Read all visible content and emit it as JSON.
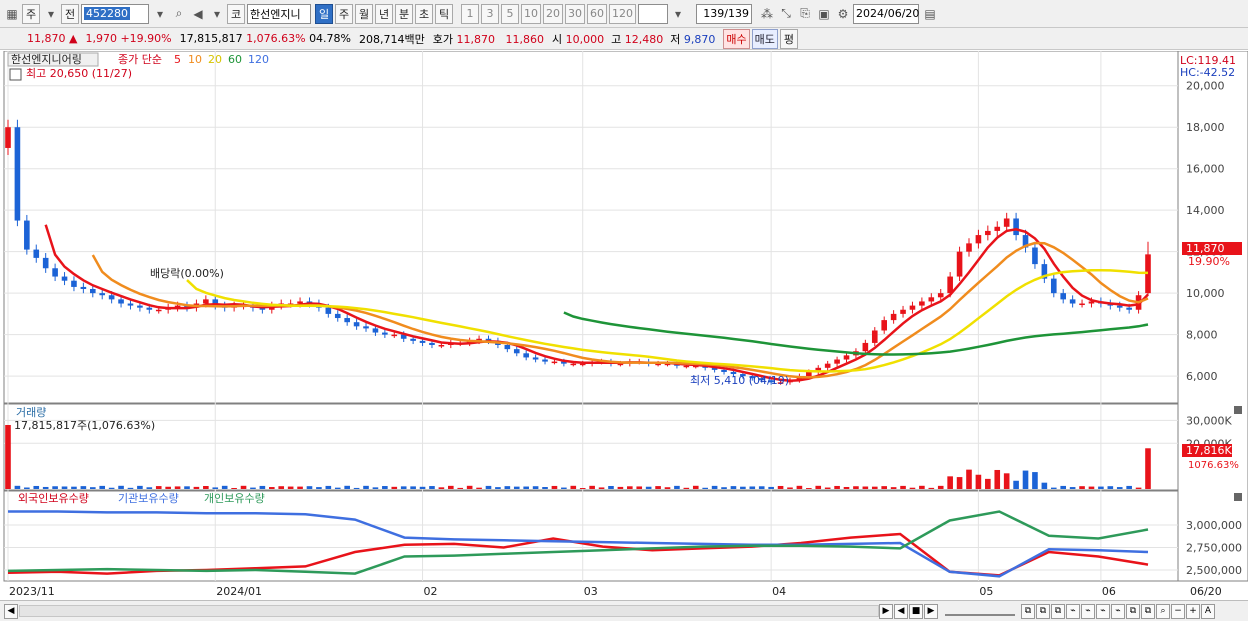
{
  "toolbar": {
    "type_label": "주",
    "prev_label": "전",
    "code": "452280",
    "stock_prefix": "코",
    "stock_name": "한선엔지니",
    "periods": [
      "일",
      "주",
      "월",
      "년",
      "분",
      "초",
      "틱"
    ],
    "active_period": "일",
    "numbers": [
      "1",
      "3",
      "5",
      "10",
      "20",
      "30",
      "60",
      "120"
    ],
    "count": "139",
    "total": "/139",
    "date": "2024/06/20"
  },
  "quote": {
    "price": "11,870",
    "arrow": "▲",
    "change": "1,970",
    "change_pct": "+19.90%",
    "volume": "17,815,817",
    "volume_pct": "1,076.63%",
    "turnover": "04.78%",
    "amount": "208,714백만",
    "bid_label": "호가",
    "ask": "11,870",
    "bid": "11,860",
    "open_label": "시",
    "open": "10,000",
    "high_label": "고",
    "high": "12,480",
    "low_label": "저",
    "low": "9,870",
    "buy_label": "매수",
    "sell_label": "매도",
    "flat_label": "평"
  },
  "price_panel": {
    "title": "한선엔지니어링",
    "ma_label": "종가 단순",
    "ma_periods": [
      "5",
      "10",
      "20",
      "60",
      "120"
    ],
    "high_note": "최고 20,650 (11/27)",
    "low_note": "최저 5,410 (04/19)",
    "dividend_note": "배당락(0.00%)",
    "lc": "LC:119.41",
    "hc": "HC:-42.52",
    "y_ticks": [
      "20,000",
      "18,000",
      "16,000",
      "14,000",
      "12,000",
      "10,000",
      "8,000",
      "6,000"
    ],
    "last_price": "11,870",
    "last_pct": "19.90%"
  },
  "volume_panel": {
    "title": "거래량",
    "note": "17,815,817주(1,076.63%)",
    "y_ticks": [
      "30,000K",
      "20,000K"
    ],
    "last_vol": "17,816K",
    "last_pct": "1076.63%"
  },
  "holding_panel": {
    "series_labels": [
      "외국인보유수량",
      "기관보유수량",
      "개인보유수량"
    ],
    "y_ticks": [
      "3,000,000",
      "2,750,000",
      "2,500,000"
    ]
  },
  "x_axis": {
    "labels": [
      "2023/11",
      "2024/01",
      "02",
      "03",
      "04",
      "05",
      "06"
    ],
    "end_label": "06/20"
  },
  "colors": {
    "up": "#e8131a",
    "down": "#1c63d6",
    "ma5": "#e8131a",
    "ma10": "#f08c1e",
    "ma20": "#f0e000",
    "ma60": "#1e9438",
    "ma120": "#3f6fe0",
    "foreign": "#e8131a",
    "institution": "#3f6fe0",
    "individual": "#2e9a5a"
  },
  "chart_data": {
    "type": "candlestick",
    "x": [
      "2023/11",
      "2024/01",
      "02",
      "03",
      "04",
      "05",
      "06",
      "06/20"
    ],
    "price_range": [
      4800,
      21000
    ],
    "price_ticks": [
      6000,
      8000,
      10000,
      12000,
      14000,
      16000,
      18000,
      20000
    ],
    "highest": {
      "value": 20650,
      "date": "11/27"
    },
    "lowest": {
      "value": 5410,
      "date": "04/19"
    },
    "last": {
      "open": 10000,
      "high": 12480,
      "low": 9870,
      "close": 11870,
      "change_pct": 19.9
    },
    "close_series": [
      18000,
      13500,
      12100,
      11700,
      11200,
      10800,
      10600,
      10300,
      10200,
      10000,
      9900,
      9700,
      9500,
      9400,
      9300,
      9200,
      9200,
      9300,
      9400,
      9300,
      9500,
      9700,
      9400,
      9300,
      9400,
      9400,
      9300,
      9200,
      9400,
      9500,
      9500,
      9600,
      9500,
      9300,
      9000,
      8800,
      8600,
      8400,
      8300,
      8100,
      8000,
      8000,
      7800,
      7700,
      7600,
      7500,
      7500,
      7600,
      7600,
      7700,
      7800,
      7700,
      7500,
      7300,
      7100,
      6900,
      6800,
      6700,
      6700,
      6600,
      6600,
      6600,
      6700,
      6700,
      6600,
      6600,
      6700,
      6700,
      6600,
      6600,
      6600,
      6500,
      6500,
      6500,
      6400,
      6300,
      6200,
      6100,
      6000,
      5900,
      5800,
      5700,
      5700,
      5800,
      6000,
      6200,
      6400,
      6600,
      6800,
      7000,
      7200,
      7600,
      8200,
      8700,
      9000,
      9200,
      9400,
      9600,
      9800,
      10000,
      10800,
      12000,
      12400,
      12800,
      13000,
      13200,
      13600,
      12800,
      12200,
      11400,
      10700,
      10000,
      9700,
      9500,
      9500,
      9600,
      9500,
      9400,
      9300,
      9200,
      9900,
      11870
    ],
    "volume_range": [
      0,
      35000
    ],
    "volume_unit": "K",
    "volume_ticks": [
      20000,
      30000
    ],
    "last_volume": 17816,
    "holding_range": [
      2400000,
      3200000
    ],
    "holding_ticks": [
      2500000,
      2750000,
      3000000
    ],
    "series": [
      {
        "name": "외국인보유수량",
        "values": [
          2470000,
          2480000,
          2460000,
          2490000,
          2500000,
          2520000,
          2540000,
          2700000,
          2780000,
          2790000,
          2750000,
          2850000,
          2760000,
          2720000,
          2740000,
          2760000,
          2800000,
          2860000,
          2900000,
          2480000,
          2440000,
          2700000,
          2650000,
          2560000
        ]
      },
      {
        "name": "기관보유수량",
        "values": [
          3150000,
          3150000,
          3140000,
          3140000,
          3130000,
          3130000,
          3120000,
          3060000,
          2860000,
          2840000,
          2830000,
          2820000,
          2810000,
          2800000,
          2790000,
          2780000,
          2780000,
          2790000,
          2800000,
          2480000,
          2430000,
          2730000,
          2720000,
          2700000
        ]
      },
      {
        "name": "개인보유수량",
        "values": [
          2490000,
          2500000,
          2510000,
          2500000,
          2490000,
          2500000,
          2480000,
          2460000,
          2650000,
          2660000,
          2680000,
          2700000,
          2720000,
          2740000,
          2760000,
          2770000,
          2770000,
          2760000,
          2740000,
          3050000,
          3150000,
          2880000,
          2850000,
          2950000
        ]
      }
    ]
  }
}
